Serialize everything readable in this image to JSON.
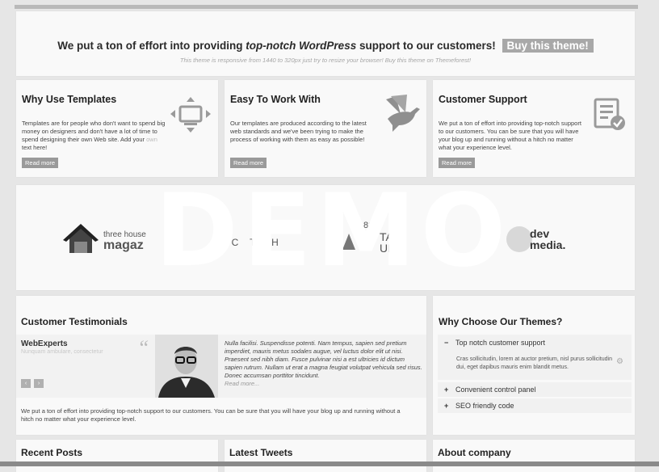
{
  "banner": {
    "text_before": "We put a ton of effort into providing ",
    "text_em": "top-notch WordPress",
    "text_after": " support to our customers!",
    "buy_label": "Buy this theme!",
    "sub": "This theme is responsive from 1440 to 320px just try to resize your browser! Buy this theme on Themeforest!"
  },
  "features": [
    {
      "title": "Why Use Templates",
      "text_before": "Templates are for people who don't want to spend big money on designers and don't have a lot of time to spend designing their own Web site. Add your ",
      "accent": "own",
      "text_after": " text here!",
      "more": "Read more",
      "icon": "resize-monitor-icon"
    },
    {
      "title": "Easy To Work With",
      "text": "Our templates are produced according to the latest web standards and we've been trying to make the process of working with them as easy as possible!",
      "more": "Read more",
      "icon": "dove-icon"
    },
    {
      "title": "Customer Support",
      "text": "We put a ton of effort into providing top-notch support to our customers. You can be sure that you will have your blog up and running without a hitch no matter what your experience level.",
      "more": "Read more",
      "icon": "checklist-icon"
    }
  ],
  "logos": {
    "logo1_top": "three house",
    "logo1_bottom": "magaz",
    "logo2": "FFC   TECH",
    "logo3_a": "86",
    "logo3_b": "TA",
    "logo3_c": "UP",
    "logo4_a": "dev",
    "logo4_b": "media."
  },
  "testimonials": {
    "title": "Customer Testimonials",
    "name": "WebExperts",
    "sub": "Nunquam ambulare, consectetur",
    "quote": "Nulla facilisi. Suspendisse potenti. Nam tempus, sapien sed pretium imperdiet, mauris metus sodales augue, vel luctus dolor elit ut nisi. Praesent sed nibh diam. Fusce pulvinar nisi a est ultricies id dictum sapien rutrum. Nullam ut erat a magna feugiat volutpat vehicula sed risus. Donec accumsan porttitor tincidunt.",
    "read_more": "Read more...",
    "prev": "‹",
    "next": "›",
    "bottom": "We put a ton of effort into providing top-notch support to our customers. You can be sure that you will have your blog up and running without a hitch no matter what your experience level."
  },
  "why": {
    "title": "Why Choose Our Themes?",
    "items": [
      {
        "sign": "−",
        "label": "Top notch customer support",
        "body": "Cras sollicitudin, lorem at auctor pretium, nisl purus sollicitudin dui, eget dapibus mauris enim blandit metus."
      },
      {
        "sign": "+",
        "label": "Convenient control panel"
      },
      {
        "sign": "+",
        "label": "SEO friendly code"
      }
    ]
  },
  "bottom": {
    "recent_posts": "Recent Posts",
    "latest_tweets": "Latest Tweets",
    "about": "About company"
  },
  "watermark": "DEMO"
}
